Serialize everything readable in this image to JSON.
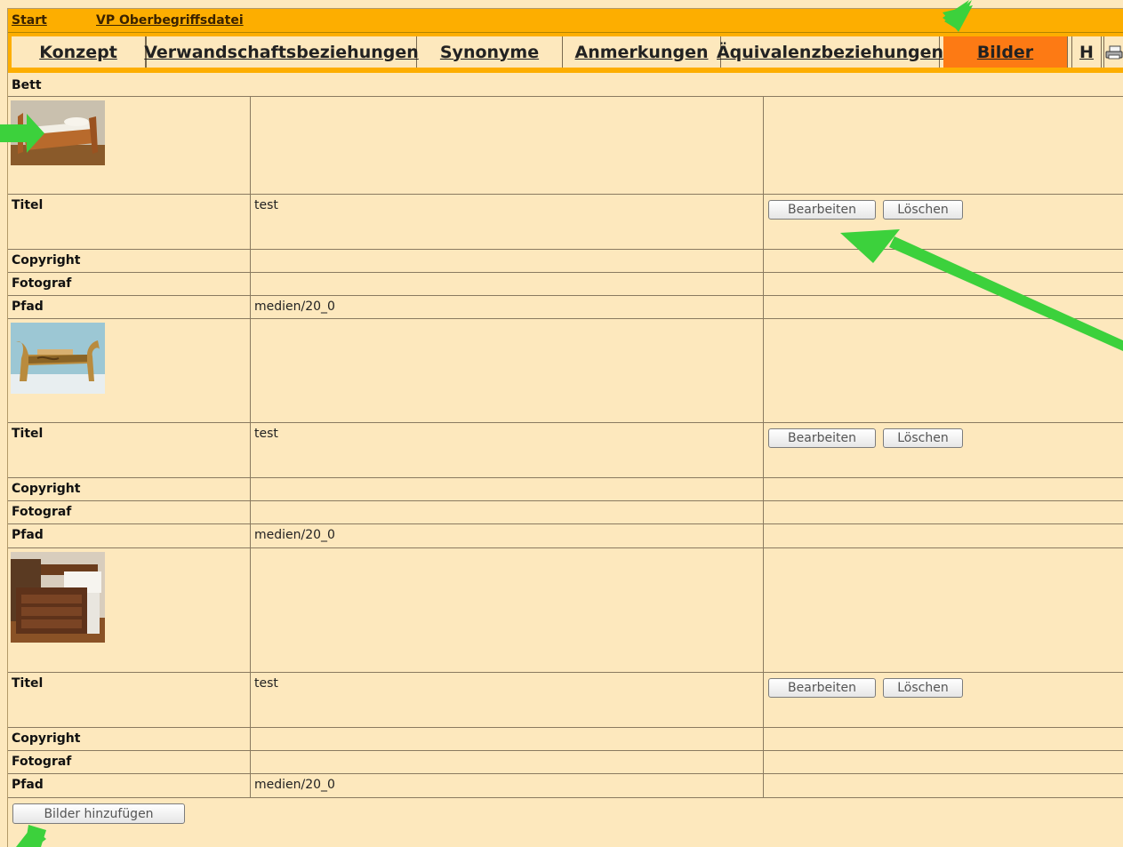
{
  "breadcrumb": {
    "start": "Start",
    "parent": "VP Oberbegriffsdatei"
  },
  "tabs": [
    {
      "label": "Konzept"
    },
    {
      "label": "Verwandschaftsbeziehungen"
    },
    {
      "label": "Synonyme"
    },
    {
      "label": "Anmerkungen"
    },
    {
      "label": "Äquivalenzbeziehungen"
    },
    {
      "label": "Bilder"
    },
    {
      "label": "H"
    }
  ],
  "active_tab": "Bilder",
  "concept_title": "Bett",
  "field_labels": {
    "title": "Titel",
    "copyright": "Copyright",
    "photographer": "Fotograf",
    "path": "Pfad"
  },
  "images": [
    {
      "title": "test",
      "copyright": "",
      "photographer": "",
      "path": "medien/20_0"
    },
    {
      "title": "test",
      "copyright": "",
      "photographer": "",
      "path": "medien/20_0"
    },
    {
      "title": "test",
      "copyright": "",
      "photographer": "",
      "path": "medien/20_0"
    }
  ],
  "buttons": {
    "edit": "Bearbeiten",
    "delete": "Löschen",
    "add_images": "Bilder hinzufügen"
  },
  "icons": {
    "print": "printer-icon",
    "annotation": "green-arrow"
  },
  "colors": {
    "tab_bar": "#fdae00",
    "active_tab": "#fd7a14",
    "content_bg": "#fde8bd",
    "arrow": "#3cd13c"
  }
}
